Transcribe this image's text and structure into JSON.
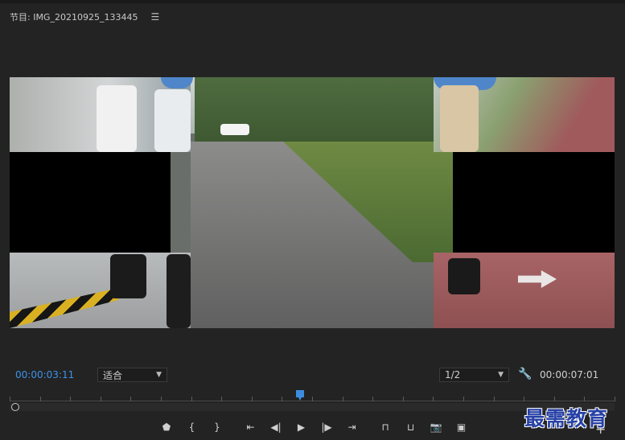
{
  "panel": {
    "title": "节目: IMG_20210925_133445",
    "menu_icon": "hamburger-menu-icon"
  },
  "controls": {
    "current_time": "00:00:03:11",
    "fit_label": "适合",
    "resolution": "1/2",
    "duration": "00:00:07:01",
    "settings_icon": "wrench-icon"
  },
  "timeline": {
    "playhead_fraction": 0.48
  },
  "transport": {
    "buttons": [
      {
        "name": "add-marker-button",
        "glyph": "⬟"
      },
      {
        "name": "mark-in-button",
        "glyph": "{"
      },
      {
        "name": "mark-out-button",
        "glyph": "}"
      },
      {
        "name": "go-to-in-button",
        "glyph": "⇤"
      },
      {
        "name": "step-back-button",
        "glyph": "◀|"
      },
      {
        "name": "play-button",
        "glyph": "▶"
      },
      {
        "name": "step-forward-button",
        "glyph": "|▶"
      },
      {
        "name": "go-to-out-button",
        "glyph": "⇥"
      },
      {
        "name": "lift-button",
        "glyph": "⊓"
      },
      {
        "name": "extract-button",
        "glyph": "⊔"
      },
      {
        "name": "export-frame-button",
        "glyph": "📷"
      },
      {
        "name": "comparison-view-button",
        "glyph": "▣"
      }
    ],
    "add_button": "+"
  },
  "watermark": "最需教育",
  "colors": {
    "accent": "#3c92e8",
    "background": "#232323"
  }
}
